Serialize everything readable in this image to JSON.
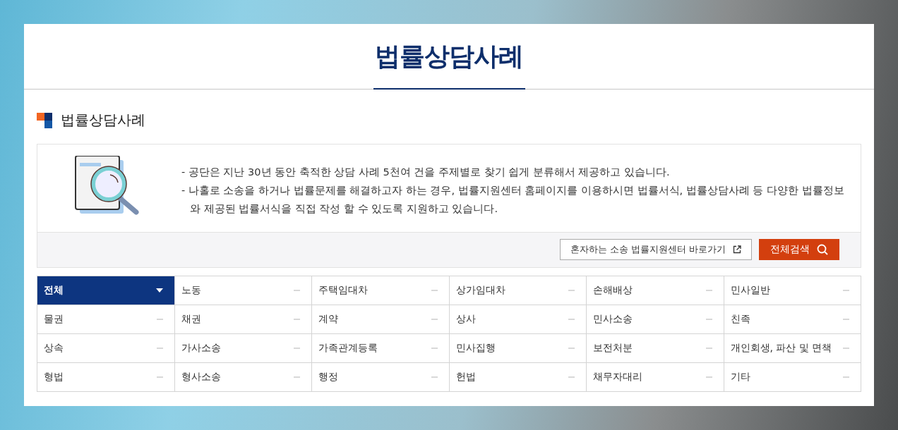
{
  "page_title": "법률상담사례",
  "section_title": "법률상담사례",
  "intro": {
    "lines": [
      "- 공단은 지난 30년 동안 축적한 상담 사례 5천여 건을 주제별로 찾기 쉽게 분류해서 제공하고 있습니다.",
      "- 나홀로 소송을 하거나 법률문제를 해결하고자 하는 경우, 법률지원센터 홈페이지를 이용하시면 법률서식, 법률상담사례 등 다양한 법률정보와 제공된 법률서식을 직접 작성 할 수 있도록 지원하고 있습니다."
    ]
  },
  "buttons": {
    "external_link": "혼자하는 소송 법률지원센터 바로가기",
    "search_all": "전체검색"
  },
  "categories": [
    {
      "label": "전체",
      "selected": true
    },
    {
      "label": "노동",
      "selected": false
    },
    {
      "label": "주택임대차",
      "selected": false
    },
    {
      "label": "상가임대차",
      "selected": false
    },
    {
      "label": "손해배상",
      "selected": false
    },
    {
      "label": "민사일반",
      "selected": false
    },
    {
      "label": "물권",
      "selected": false
    },
    {
      "label": "채권",
      "selected": false
    },
    {
      "label": "계약",
      "selected": false
    },
    {
      "label": "상사",
      "selected": false
    },
    {
      "label": "민사소송",
      "selected": false
    },
    {
      "label": "친족",
      "selected": false
    },
    {
      "label": "상속",
      "selected": false
    },
    {
      "label": "가사소송",
      "selected": false
    },
    {
      "label": "가족관계등록",
      "selected": false
    },
    {
      "label": "민사집행",
      "selected": false
    },
    {
      "label": "보전처분",
      "selected": false
    },
    {
      "label": "개인회생, 파산 및 면책",
      "selected": false
    },
    {
      "label": "형법",
      "selected": false
    },
    {
      "label": "형사소송",
      "selected": false
    },
    {
      "label": "행정",
      "selected": false
    },
    {
      "label": "헌법",
      "selected": false
    },
    {
      "label": "채무자대리",
      "selected": false
    },
    {
      "label": "기타",
      "selected": false
    }
  ]
}
